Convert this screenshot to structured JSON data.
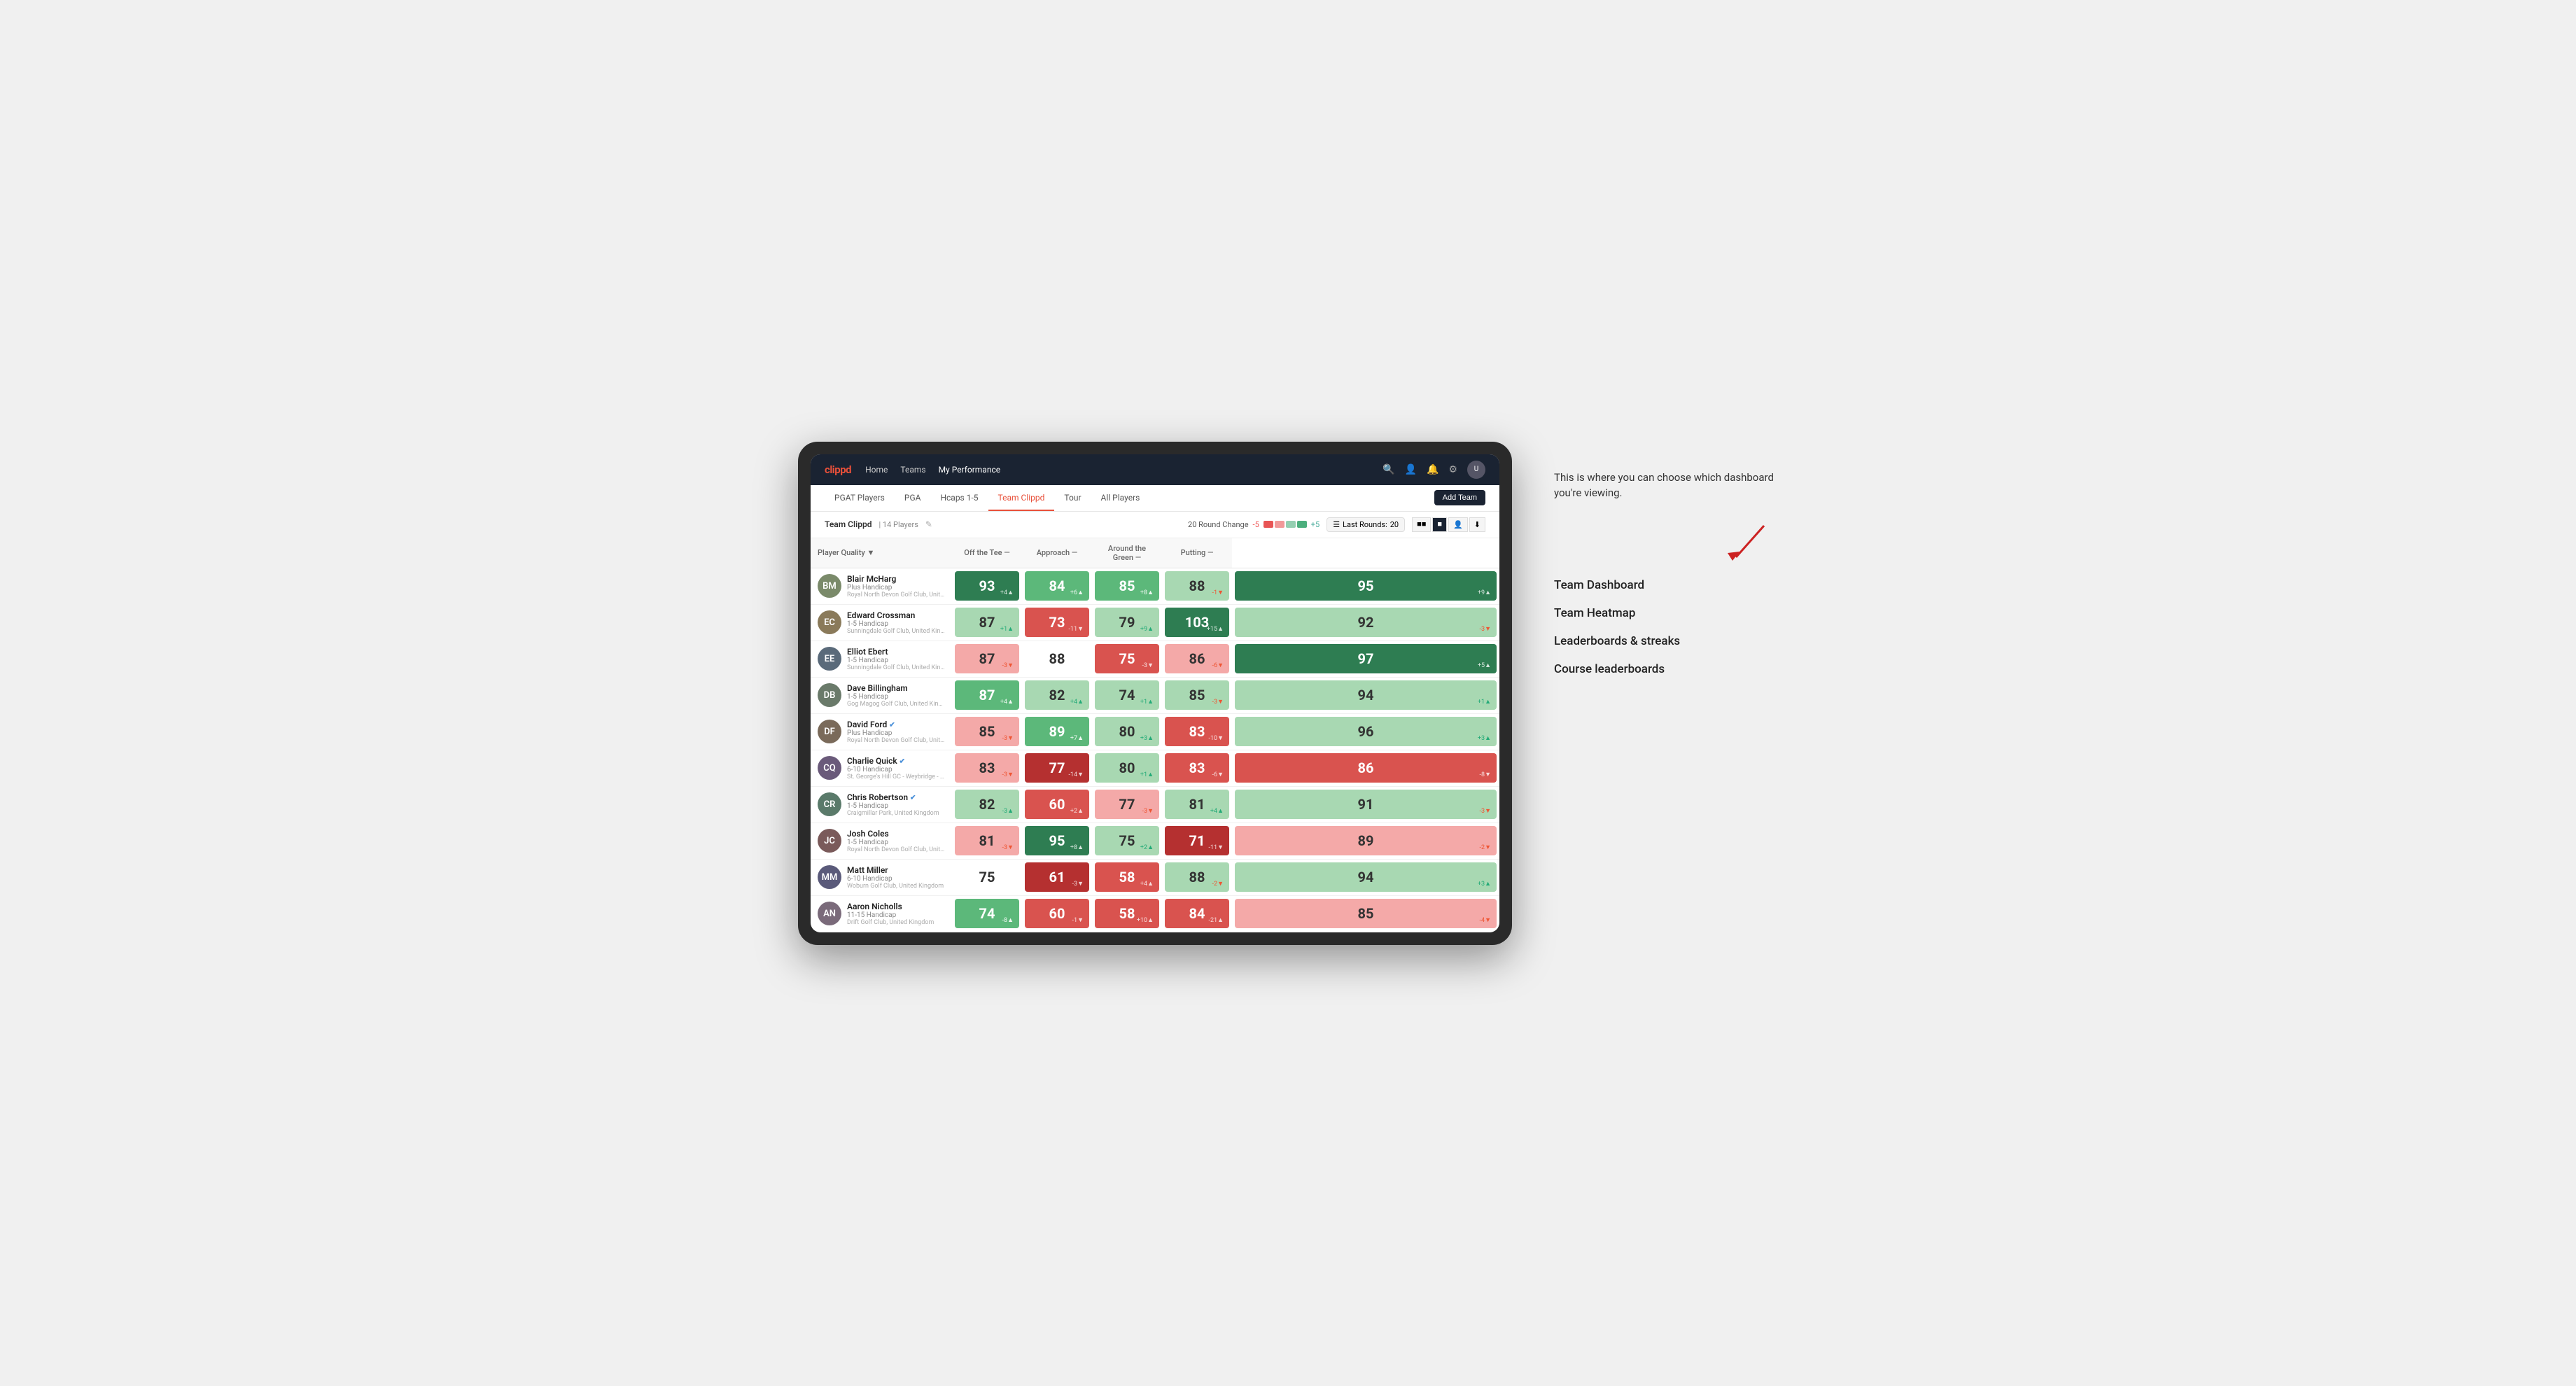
{
  "annotation": {
    "intro_text": "This is where you can choose which dashboard you're viewing.",
    "dashboard_options": [
      "Team Dashboard",
      "Team Heatmap",
      "Leaderboards & streaks",
      "Course leaderboards"
    ]
  },
  "nav": {
    "logo": "clippd",
    "links": [
      {
        "label": "Home",
        "active": false
      },
      {
        "label": "Teams",
        "active": false
      },
      {
        "label": "My Performance",
        "active": true
      }
    ],
    "icons": [
      "search",
      "person",
      "bell",
      "settings",
      "avatar"
    ]
  },
  "sub_nav": {
    "links": [
      {
        "label": "PGAT Players",
        "active": false
      },
      {
        "label": "PGA",
        "active": false
      },
      {
        "label": "Hcaps 1-5",
        "active": false
      },
      {
        "label": "Team Clippd",
        "active": true
      },
      {
        "label": "Tour",
        "active": false
      },
      {
        "label": "All Players",
        "active": false
      }
    ],
    "add_team_label": "Add Team"
  },
  "team_header": {
    "name": "Team Clippd",
    "count": "14 Players",
    "round_change_label": "20 Round Change",
    "change_min": "-5",
    "change_max": "+5",
    "last_rounds_label": "Last Rounds:",
    "last_rounds_value": "20"
  },
  "table": {
    "headers": {
      "player": "Player Quality ▼",
      "off_tee": "Off the Tee —",
      "approach": "Approach —",
      "around_green": "Around the Green —",
      "putting": "Putting —"
    },
    "rows": [
      {
        "name": "Blair McHarg",
        "handicap": "Plus Handicap",
        "club": "Royal North Devon Golf Club, United Kingdom",
        "avatar_color": "#7a8a6a",
        "initials": "BM",
        "metrics": {
          "player_quality": {
            "value": 93,
            "change": "+4▲",
            "bg": "bg-dark-green"
          },
          "off_tee": {
            "value": 84,
            "change": "+6▲",
            "bg": "bg-green"
          },
          "approach": {
            "value": 85,
            "change": "+8▲",
            "bg": "bg-green"
          },
          "around_green": {
            "value": 88,
            "change": "-1▼",
            "bg": "bg-light-green"
          },
          "putting": {
            "value": 95,
            "change": "+9▲",
            "bg": "bg-dark-green"
          }
        }
      },
      {
        "name": "Edward Crossman",
        "handicap": "1-5 Handicap",
        "club": "Sunningdale Golf Club, United Kingdom",
        "avatar_color": "#8a7a5a",
        "initials": "EC",
        "metrics": {
          "player_quality": {
            "value": 87,
            "change": "+1▲",
            "bg": "bg-light-green"
          },
          "off_tee": {
            "value": 73,
            "change": "-11▼",
            "bg": "bg-red"
          },
          "approach": {
            "value": 79,
            "change": "+9▲",
            "bg": "bg-light-green"
          },
          "around_green": {
            "value": 103,
            "change": "+15▲",
            "bg": "bg-dark-green"
          },
          "putting": {
            "value": 92,
            "change": "-3▼",
            "bg": "bg-light-green"
          }
        }
      },
      {
        "name": "Elliot Ebert",
        "handicap": "1-5 Handicap",
        "club": "Sunningdale Golf Club, United Kingdom",
        "avatar_color": "#5a6a7a",
        "initials": "EE",
        "metrics": {
          "player_quality": {
            "value": 87,
            "change": "-3▼",
            "bg": "bg-light-red"
          },
          "off_tee": {
            "value": 88,
            "change": "",
            "bg": "bg-white"
          },
          "approach": {
            "value": 75,
            "change": "-3▼",
            "bg": "bg-red"
          },
          "around_green": {
            "value": 86,
            "change": "-6▼",
            "bg": "bg-light-red"
          },
          "putting": {
            "value": 97,
            "change": "+5▲",
            "bg": "bg-dark-green"
          }
        }
      },
      {
        "name": "Dave Billingham",
        "handicap": "1-5 Handicap",
        "club": "Gog Magog Golf Club, United Kingdom",
        "avatar_color": "#6a7a6a",
        "initials": "DB",
        "metrics": {
          "player_quality": {
            "value": 87,
            "change": "+4▲",
            "bg": "bg-green"
          },
          "off_tee": {
            "value": 82,
            "change": "+4▲",
            "bg": "bg-light-green"
          },
          "approach": {
            "value": 74,
            "change": "+1▲",
            "bg": "bg-light-green"
          },
          "around_green": {
            "value": 85,
            "change": "-3▼",
            "bg": "bg-light-green"
          },
          "putting": {
            "value": 94,
            "change": "+1▲",
            "bg": "bg-light-green"
          }
        }
      },
      {
        "name": "David Ford",
        "handicap": "Plus Handicap",
        "club": "Royal North Devon Golf Club, United Kingdom",
        "avatar_color": "#7a6a5a",
        "initials": "DF",
        "verified": true,
        "metrics": {
          "player_quality": {
            "value": 85,
            "change": "-3▼",
            "bg": "bg-light-red"
          },
          "off_tee": {
            "value": 89,
            "change": "+7▲",
            "bg": "bg-green"
          },
          "approach": {
            "value": 80,
            "change": "+3▲",
            "bg": "bg-light-green"
          },
          "around_green": {
            "value": 83,
            "change": "-10▼",
            "bg": "bg-red"
          },
          "putting": {
            "value": 96,
            "change": "+3▲",
            "bg": "bg-light-green"
          }
        }
      },
      {
        "name": "Charlie Quick",
        "handicap": "6-10 Handicap",
        "club": "St. George's Hill GC - Weybridge - Surrey, Uni...",
        "avatar_color": "#6a5a7a",
        "initials": "CQ",
        "verified": true,
        "metrics": {
          "player_quality": {
            "value": 83,
            "change": "-3▼",
            "bg": "bg-light-red"
          },
          "off_tee": {
            "value": 77,
            "change": "-14▼",
            "bg": "bg-dark-red"
          },
          "approach": {
            "value": 80,
            "change": "+1▲",
            "bg": "bg-light-green"
          },
          "around_green": {
            "value": 83,
            "change": "-6▼",
            "bg": "bg-red"
          },
          "putting": {
            "value": 86,
            "change": "-8▼",
            "bg": "bg-red"
          }
        }
      },
      {
        "name": "Chris Robertson",
        "handicap": "1-5 Handicap",
        "club": "Craigmillar Park, United Kingdom",
        "avatar_color": "#5a7a6a",
        "initials": "CR",
        "verified": true,
        "metrics": {
          "player_quality": {
            "value": 82,
            "change": "-3▲",
            "bg": "bg-light-green"
          },
          "off_tee": {
            "value": 60,
            "change": "+2▲",
            "bg": "bg-red"
          },
          "approach": {
            "value": 77,
            "change": "-3▼",
            "bg": "bg-light-red"
          },
          "around_green": {
            "value": 81,
            "change": "+4▲",
            "bg": "bg-light-green"
          },
          "putting": {
            "value": 91,
            "change": "-3▼",
            "bg": "bg-light-green"
          }
        }
      },
      {
        "name": "Josh Coles",
        "handicap": "1-5 Handicap",
        "club": "Royal North Devon Golf Club, United Kingdom",
        "avatar_color": "#7a5a5a",
        "initials": "JC",
        "metrics": {
          "player_quality": {
            "value": 81,
            "change": "-3▼",
            "bg": "bg-light-red"
          },
          "off_tee": {
            "value": 95,
            "change": "+8▲",
            "bg": "bg-dark-green"
          },
          "approach": {
            "value": 75,
            "change": "+2▲",
            "bg": "bg-light-green"
          },
          "around_green": {
            "value": 71,
            "change": "-11▼",
            "bg": "bg-dark-red"
          },
          "putting": {
            "value": 89,
            "change": "-2▼",
            "bg": "bg-light-red"
          }
        }
      },
      {
        "name": "Matt Miller",
        "handicap": "6-10 Handicap",
        "club": "Woburn Golf Club, United Kingdom",
        "avatar_color": "#5a5a7a",
        "initials": "MM",
        "metrics": {
          "player_quality": {
            "value": 75,
            "change": "",
            "bg": "bg-white"
          },
          "off_tee": {
            "value": 61,
            "change": "-3▼",
            "bg": "bg-dark-red"
          },
          "approach": {
            "value": 58,
            "change": "+4▲",
            "bg": "bg-red"
          },
          "around_green": {
            "value": 88,
            "change": "-2▼",
            "bg": "bg-light-green"
          },
          "putting": {
            "value": 94,
            "change": "+3▲",
            "bg": "bg-light-green"
          }
        }
      },
      {
        "name": "Aaron Nicholls",
        "handicap": "11-15 Handicap",
        "club": "Drift Golf Club, United Kingdom",
        "avatar_color": "#7a6a7a",
        "initials": "AN",
        "metrics": {
          "player_quality": {
            "value": 74,
            "change": "-8▲",
            "bg": "bg-green"
          },
          "off_tee": {
            "value": 60,
            "change": "-1▼",
            "bg": "bg-red"
          },
          "approach": {
            "value": 58,
            "change": "+10▲",
            "bg": "bg-red"
          },
          "around_green": {
            "value": 84,
            "change": "-21▲",
            "bg": "bg-red"
          },
          "putting": {
            "value": 85,
            "change": "-4▼",
            "bg": "bg-light-red"
          }
        }
      }
    ]
  }
}
